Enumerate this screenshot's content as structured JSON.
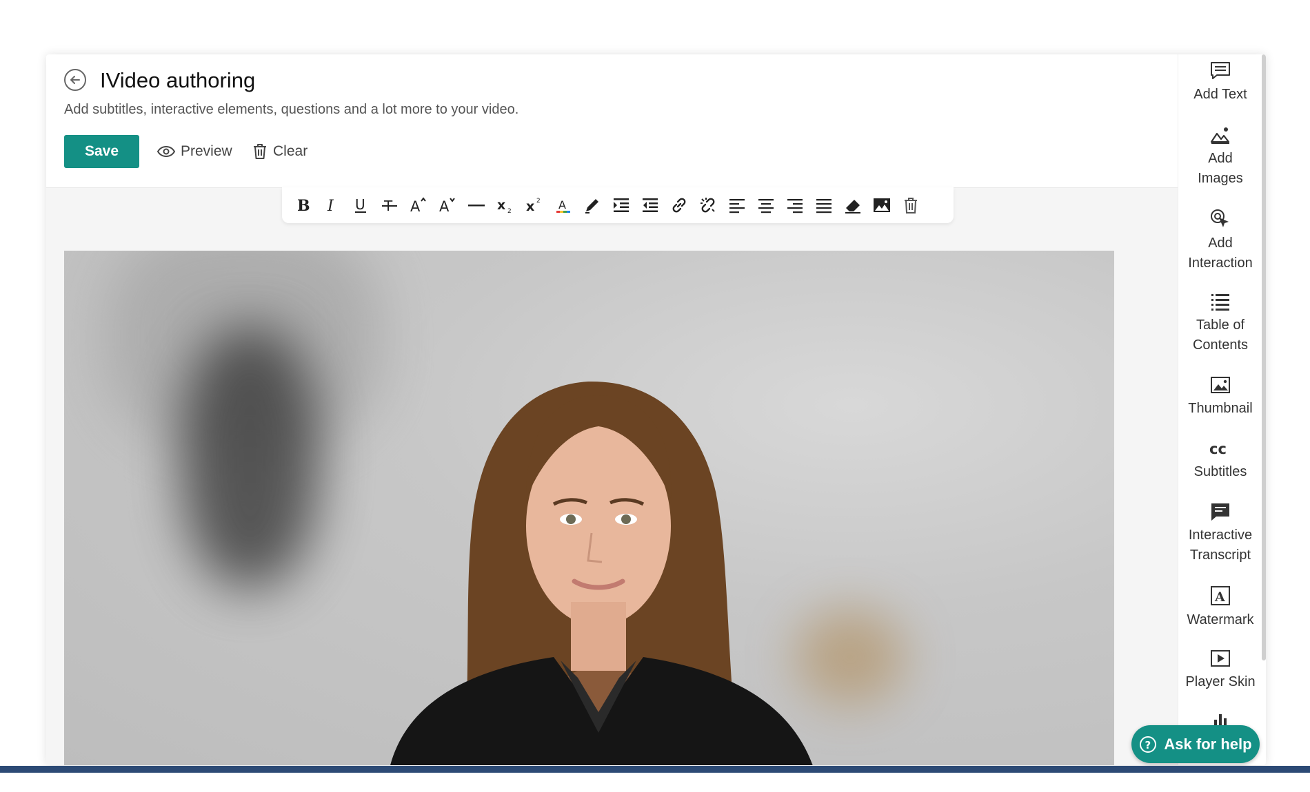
{
  "header": {
    "title": "IVideo authoring",
    "subtitle": "Add subtitles, interactive elements, questions and a lot more to your video.",
    "save_label": "Save",
    "preview_label": "Preview",
    "clear_label": "Clear"
  },
  "toolbar": {
    "tools": [
      "bold-icon",
      "italic-icon",
      "underline-icon",
      "strikethrough-icon",
      "font-size-increase-icon",
      "font-size-decrease-icon",
      "horizontal-rule-icon",
      "subscript-icon",
      "superscript-icon",
      "text-color-icon",
      "highlight-pen-icon",
      "indent-icon",
      "outdent-icon",
      "link-icon",
      "unlink-icon",
      "align-left-icon",
      "align-center-icon",
      "align-right-icon",
      "align-justify-icon",
      "eraser-icon",
      "insert-image-icon",
      "delete-icon"
    ]
  },
  "sidebar": {
    "items": [
      {
        "label1": "Add Text",
        "label2": "",
        "icon": "add-text-icon"
      },
      {
        "label1": "Add",
        "label2": "Images",
        "icon": "add-images-icon"
      },
      {
        "label1": "Add",
        "label2": "Interaction",
        "icon": "add-interaction-icon"
      },
      {
        "label1": "Table of",
        "label2": "Contents",
        "icon": "table-of-contents-icon"
      },
      {
        "label1": "Thumbnail",
        "label2": "",
        "icon": "thumbnail-icon"
      },
      {
        "label1": "Subtitles",
        "label2": "",
        "icon": "subtitles-icon"
      },
      {
        "label1": "Interactive",
        "label2": "Transcript",
        "icon": "interactive-transcript-icon"
      },
      {
        "label1": "Watermark",
        "label2": "",
        "icon": "watermark-icon"
      },
      {
        "label1": "Player Skin",
        "label2": "",
        "icon": "player-skin-icon"
      }
    ]
  },
  "help": {
    "label": "Ask for help"
  },
  "colors": {
    "accent": "#149085",
    "bottom_bar": "#2c4a75"
  }
}
